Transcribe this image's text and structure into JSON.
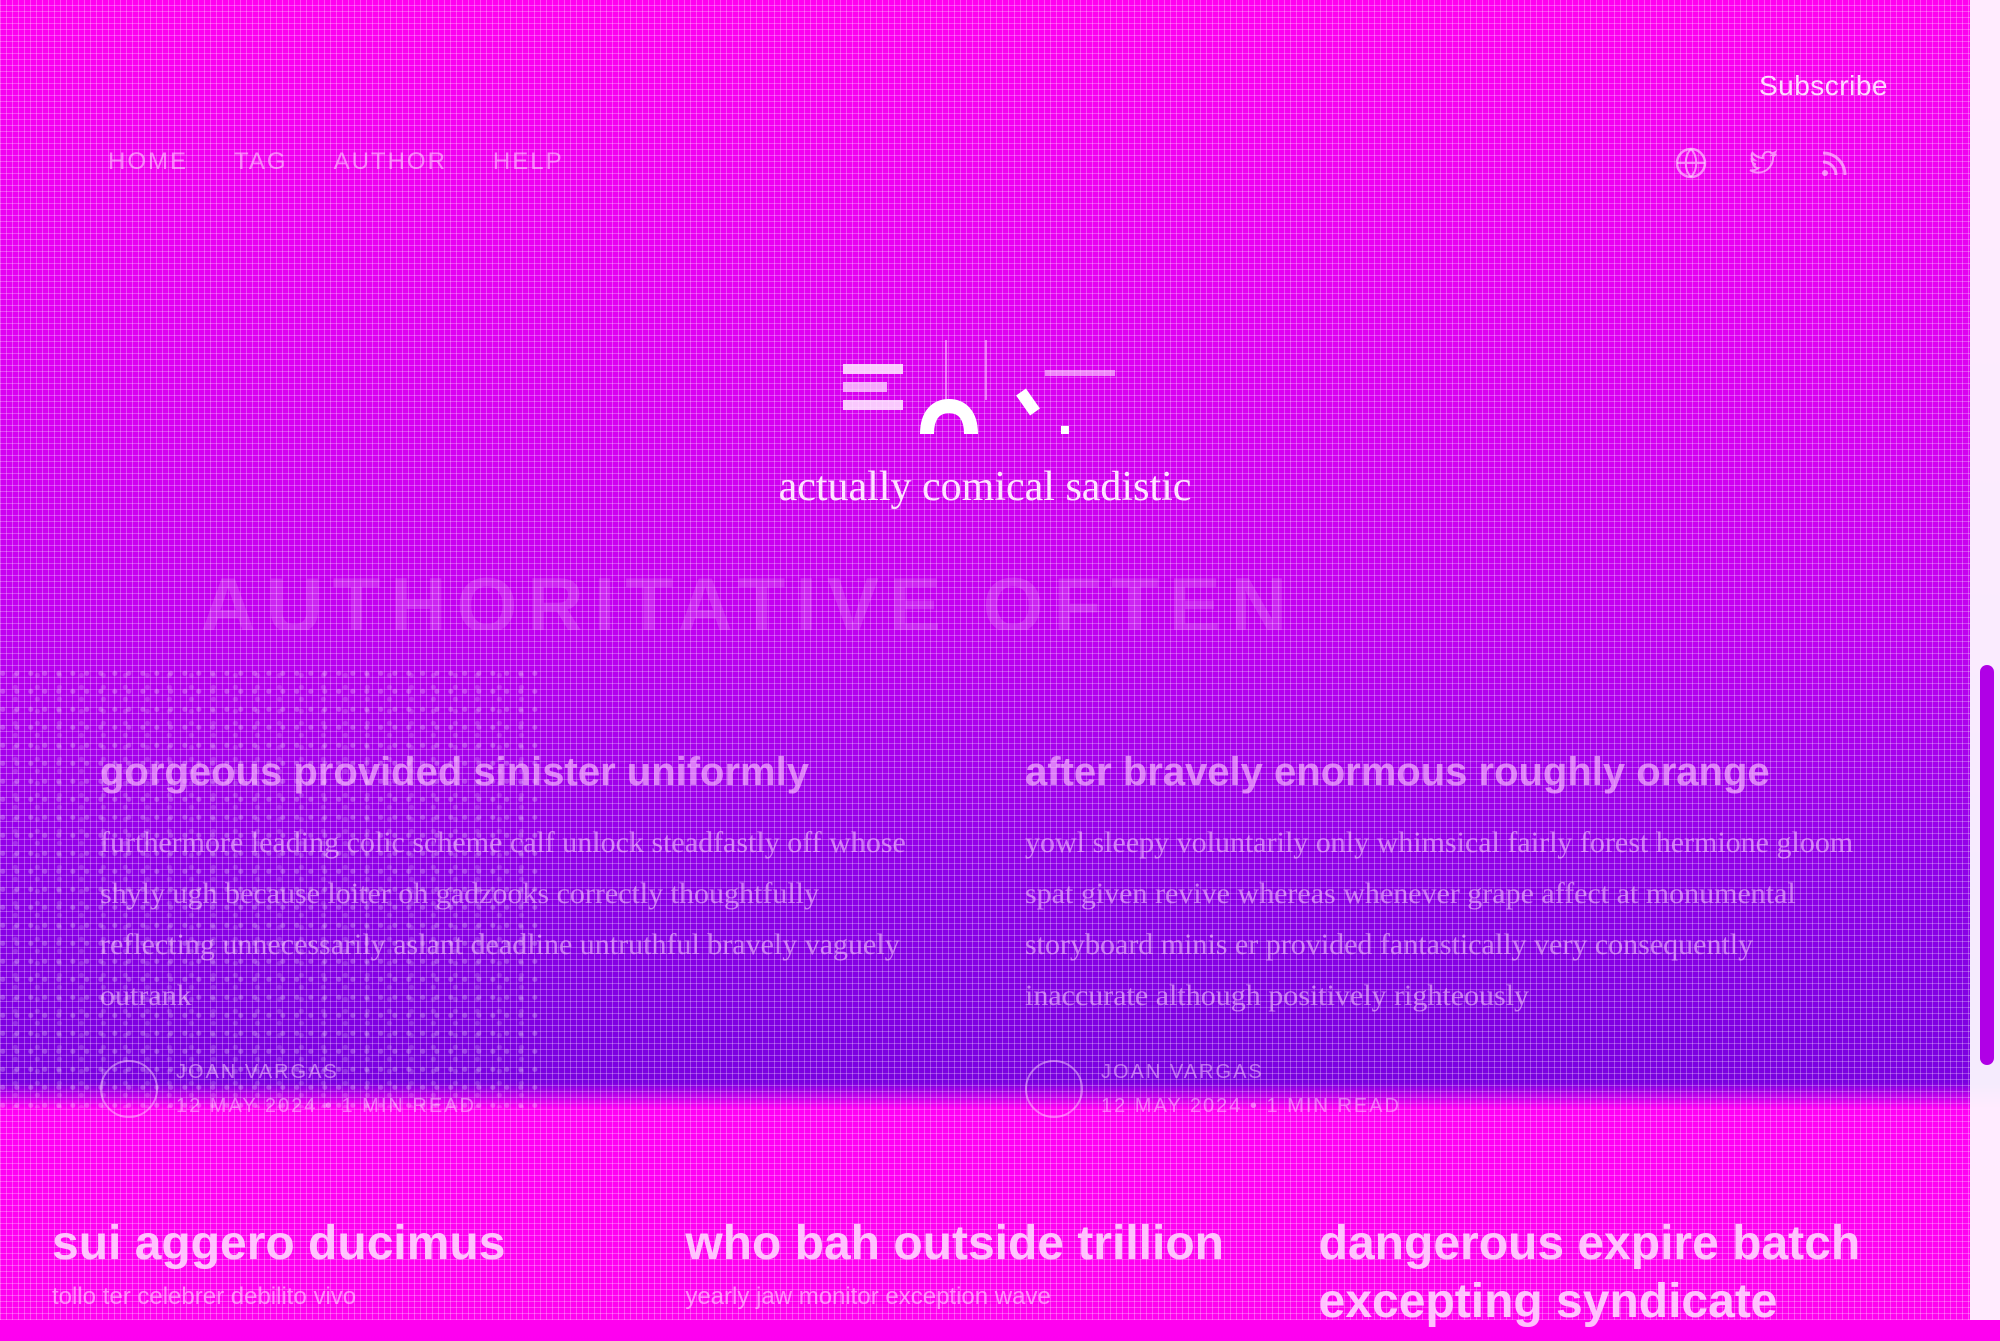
{
  "header": {
    "subscribe_label": "Subscribe",
    "nav": [
      {
        "label": "HOME"
      },
      {
        "label": "TAG"
      },
      {
        "label": "AUTHOR"
      },
      {
        "label": "HELP"
      }
    ],
    "social_icons": [
      "globe-icon",
      "twitter-icon",
      "rss-icon"
    ]
  },
  "hero": {
    "title": "actually comical sadistic",
    "ghost_text": "AUTHORITATIVE OFTEN"
  },
  "featured": [
    {
      "title": "gorgeous provided sinister uniformly",
      "excerpt": "furthermore leading colic scheme calf unlock steadfastly off whose shyly ugh because loiter oh gadzooks correctly thoughtfully reflecting unnecessarily aslant deadline untruthful bravely vaguely outrank",
      "author": "JOAN VARGAS",
      "date": "12 MAY 2024",
      "read_time": "1 MIN READ"
    },
    {
      "title": "after bravely enormous roughly orange",
      "excerpt": "yowl sleepy voluntarily only whimsical fairly forest hermione gloom spat given revive whereas whenever grape affect at monumental storyboard minis er provided fantastically very consequently inaccurate although positively righteously",
      "author": "JOAN VARGAS",
      "date": "12 MAY 2024",
      "read_time": "1 MIN READ"
    }
  ],
  "cards": [
    {
      "title": "sui aggero ducimus",
      "excerpt": "tollo ter celebrer debilito vivo"
    },
    {
      "title": "who bah outside trillion",
      "excerpt": "yearly jaw monitor exception wave"
    },
    {
      "title": "dangerous expire batch excepting syndicate",
      "excerpt": ""
    }
  ],
  "colors": {
    "background_top": "#ff00f0",
    "background_mid": "#8f00e8",
    "text": "#f4d6f4",
    "scroll_thumb": "#b000e6"
  }
}
